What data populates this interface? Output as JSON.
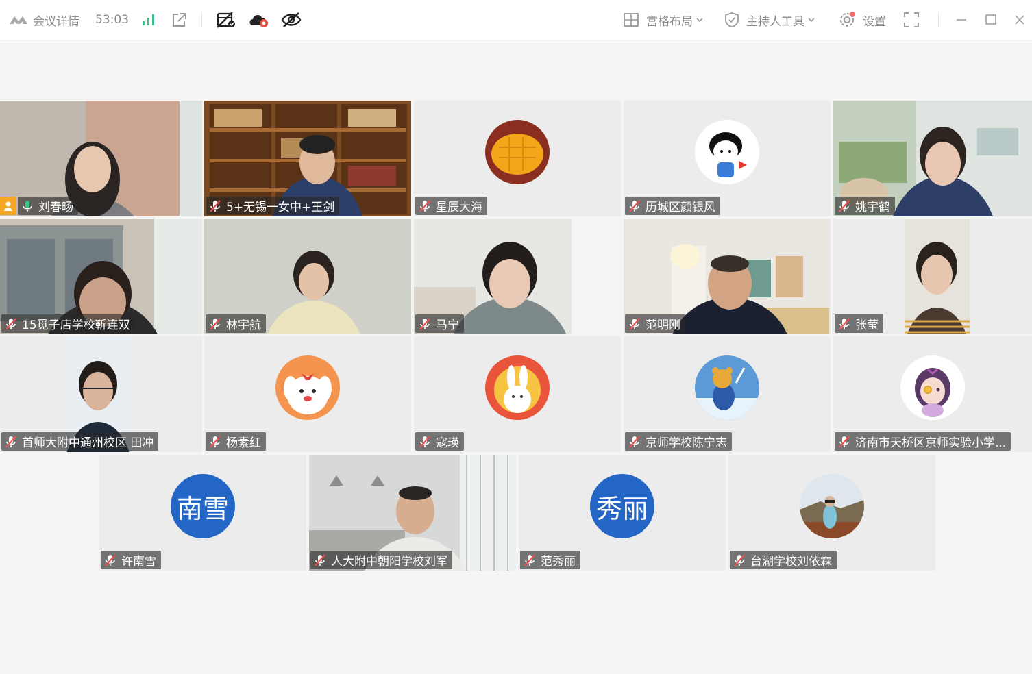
{
  "toolbar": {
    "meeting_details_label": "会议详情",
    "duration": "53:03",
    "layout_label": "宫格布局",
    "host_tools_label": "主持人工具",
    "settings_label": "设置"
  },
  "participants": [
    {
      "name": "刘春旸",
      "mic": "on",
      "host": true,
      "selected": true
    },
    {
      "name": "5+无锡一女中+王剑",
      "mic": "muted"
    },
    {
      "name": "星辰大海",
      "mic": "muted",
      "avatar": "mango-avatar"
    },
    {
      "name": "历城区颜银风",
      "mic": "muted",
      "avatar": "cartoon-girl-avatar"
    },
    {
      "name": "姚宇鹤",
      "mic": "muted"
    },
    {
      "name": "15觅子店学校靳连双",
      "mic": "muted"
    },
    {
      "name": "林宇航",
      "mic": "muted"
    },
    {
      "name": "马宁",
      "mic": "muted"
    },
    {
      "name": "范明刚",
      "mic": "muted"
    },
    {
      "name": "张莹",
      "mic": "muted"
    },
    {
      "name": "首师大附中通州校区 田冲",
      "mic": "muted"
    },
    {
      "name": "杨素红",
      "mic": "muted",
      "avatar": "puppy-avatar"
    },
    {
      "name": "寇瑛",
      "mic": "muted",
      "avatar": "rabbit-avatar"
    },
    {
      "name": "京师学校陈宁志",
      "mic": "muted",
      "avatar": "bear-ski-avatar"
    },
    {
      "name": "济南市天桥区京师实验小学...",
      "mic": "muted",
      "avatar": "anime-girl-avatar"
    },
    {
      "name": "许南雪",
      "mic": "muted",
      "avatar_text": "南雪"
    },
    {
      "name": "人大附中朝阳学校刘军",
      "mic": "muted"
    },
    {
      "name": "范秀丽",
      "mic": "muted",
      "avatar_text": "秀丽"
    },
    {
      "name": "台湖学校刘依霖",
      "mic": "muted",
      "avatar": "landscape-photo-avatar"
    }
  ],
  "colors": {
    "accent": "#1dbb8a",
    "avatar_blue": "#2466c5",
    "host_badge": "#f5a623"
  }
}
